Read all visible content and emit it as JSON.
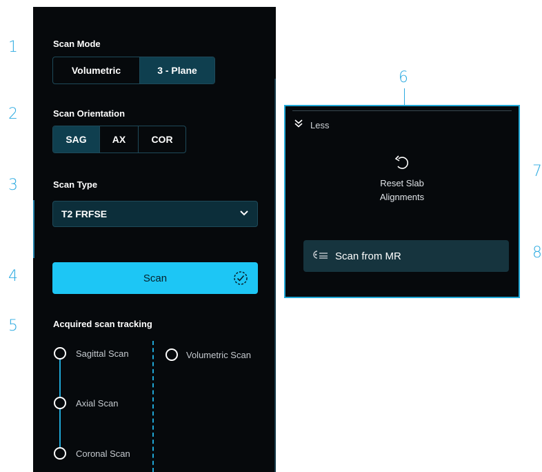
{
  "callouts": [
    "1",
    "2",
    "3",
    "4",
    "5",
    "6",
    "7",
    "8"
  ],
  "scan_mode": {
    "label": "Scan Mode",
    "options": [
      "Volumetric",
      "3 - Plane"
    ],
    "selected": "3 - Plane"
  },
  "scan_orientation": {
    "label": "Scan Orientation",
    "options": [
      "SAG",
      "AX",
      "COR"
    ],
    "selected": "SAG"
  },
  "scan_type": {
    "label": "Scan Type",
    "value": "T2 FRFSE"
  },
  "scan_button": {
    "label": "Scan"
  },
  "tracking": {
    "label": "Acquired scan tracking",
    "items": [
      "Sagittal Scan",
      "Axial Scan",
      "Coronal Scan"
    ],
    "volumetric": "Volumetric Scan"
  },
  "popover": {
    "toggle_label": "Less",
    "reset_label_line1": "Reset Slab",
    "reset_label_line2": "Alignments",
    "scan_from_mr_label": "Scan from MR"
  },
  "colors": {
    "panel_bg": "#06090c",
    "accent": "#1dc6f5",
    "callout": "#29a9e0",
    "selected": "#0f3f4f"
  }
}
